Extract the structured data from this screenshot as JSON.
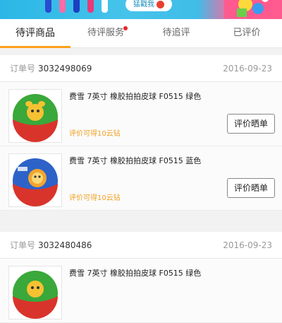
{
  "banner": {
    "cta_label": "猛戳我"
  },
  "tabs": [
    {
      "label": "待评商品",
      "active": true
    },
    {
      "label": "待评服务",
      "badge": true
    },
    {
      "label": "待追评"
    },
    {
      "label": "已评价"
    }
  ],
  "orders": [
    {
      "label": "订单号",
      "number": "3032498069",
      "date": "2016-09-23",
      "items": [
        {
          "title": "费雪 7英寸 橡胶拍拍皮球 F0515 绿色",
          "hint": "评价可得10云钻",
          "button": "评价晒单",
          "ball_color": "green"
        },
        {
          "title": "费雪 7英寸 橡胶拍拍皮球 F0515 蓝色",
          "hint": "评价可得10云钻",
          "button": "评价晒单",
          "ball_color": "blue"
        }
      ]
    },
    {
      "label": "订单号",
      "number": "3032480486",
      "date": "2016-09-23",
      "items": [
        {
          "title": "费雪 7英寸 橡胶拍拍皮球 F0515 绿色",
          "ball_color": "green"
        }
      ]
    }
  ],
  "colors": {
    "accent": "#ffa01c",
    "hint": "#f0a020",
    "badge": "#e5262b"
  }
}
